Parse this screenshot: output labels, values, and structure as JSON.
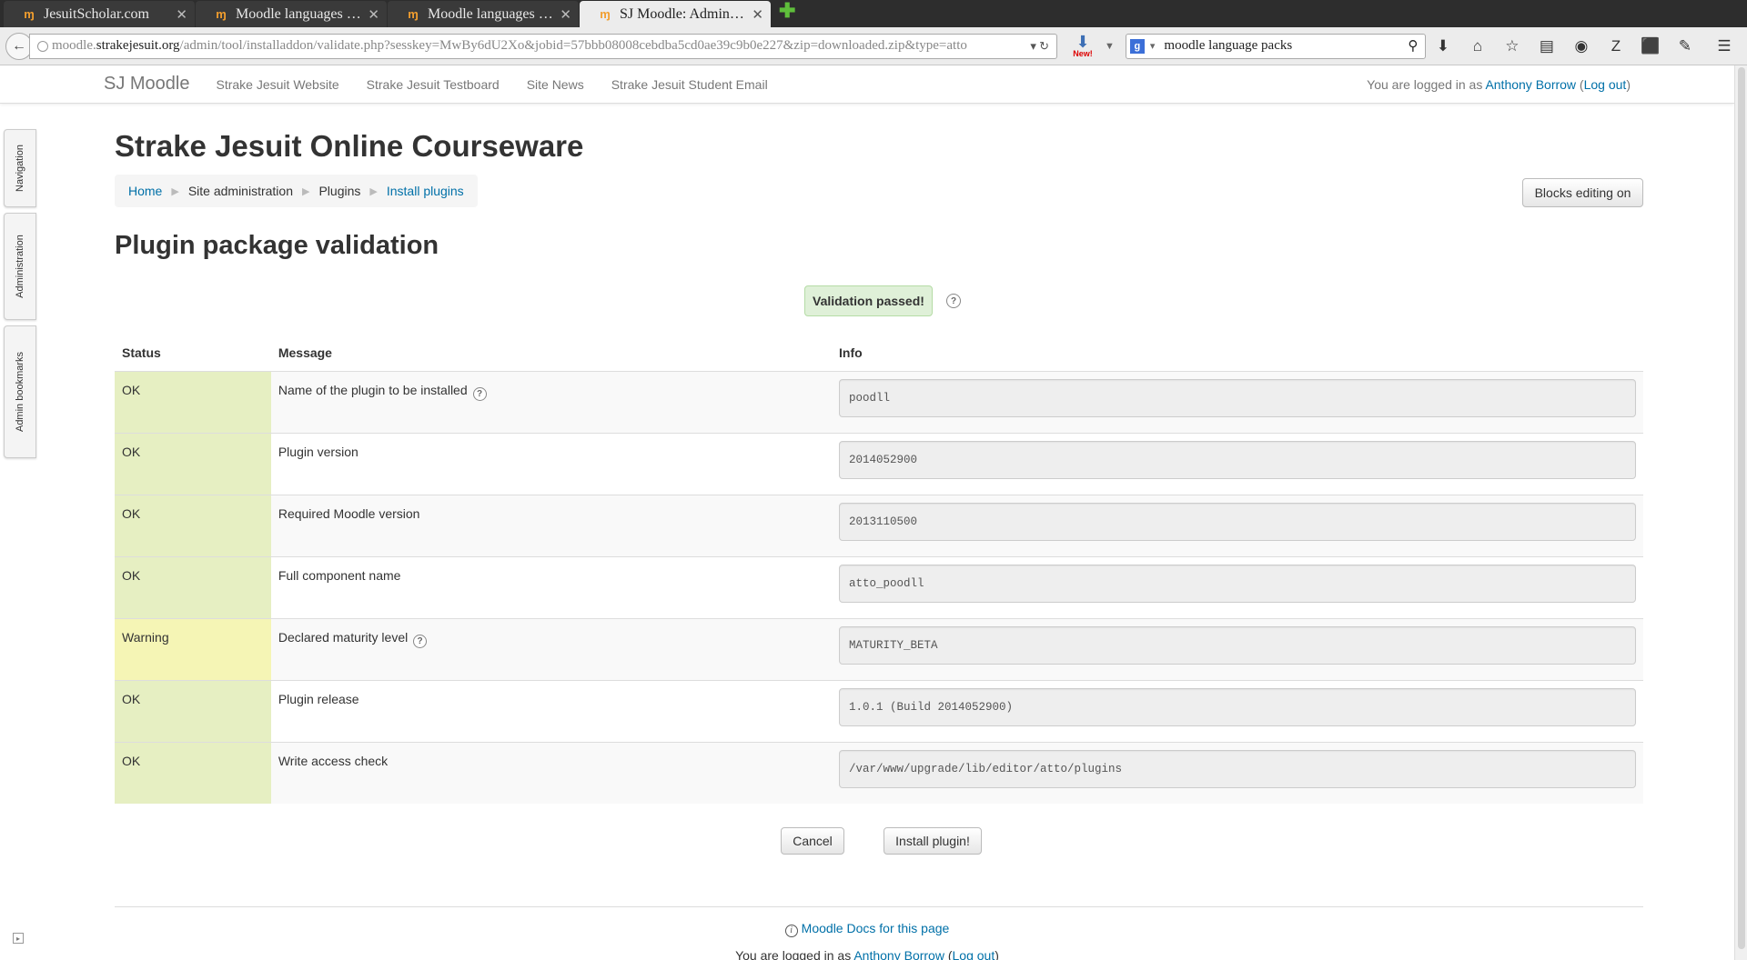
{
  "browser": {
    "tabs": [
      {
        "title": "JesuitScholar.com",
        "active": false
      },
      {
        "title": "Moodle languages po…",
        "active": false
      },
      {
        "title": "Moodle languages po…",
        "active": false
      },
      {
        "title": "SJ Moodle: Administ…",
        "active": true
      }
    ],
    "url_prefix": "moodle.",
    "url_domain": "strakejesuit.org",
    "url_path": "/admin/tool/installaddon/validate.php?sesskey=MwBy6dU2Xo&jobid=57bbb08008cebdba5cd0ae39c9b0e227&zip=downloaded.zip&type=atto",
    "download_badge": "New!",
    "search_value": "moodle language packs",
    "search_engine_glyph": "g"
  },
  "site": {
    "brand": "SJ Moodle",
    "links": [
      "Strake Jesuit Website",
      "Strake Jesuit Testboard",
      "Site News",
      "Strake Jesuit Student Email"
    ],
    "login_prefix": "You are logged in as ",
    "user": "Anthony Borrow",
    "logout": "Log out"
  },
  "side_tabs": [
    "Navigation",
    "Administration",
    "Admin bookmarks"
  ],
  "page": {
    "title": "Strake Jesuit Online Courseware",
    "breadcrumb": [
      "Home",
      "Site administration",
      "Plugins",
      "Install plugins"
    ],
    "blocks_button": "Blocks editing on",
    "heading": "Plugin package validation",
    "validation_status": "Validation passed!"
  },
  "table": {
    "headers": [
      "Status",
      "Message",
      "Info"
    ],
    "rows": [
      {
        "status": "OK",
        "message": "Name of the plugin to be installed",
        "info": "poodll",
        "help": true
      },
      {
        "status": "OK",
        "message": "Plugin version",
        "info": "2014052900",
        "help": false
      },
      {
        "status": "OK",
        "message": "Required Moodle version",
        "info": "2013110500",
        "help": false
      },
      {
        "status": "OK",
        "message": "Full component name",
        "info": "atto_poodll",
        "help": false
      },
      {
        "status": "Warning",
        "message": "Declared maturity level",
        "info": "MATURITY_BETA",
        "help": true
      },
      {
        "status": "OK",
        "message": "Plugin release",
        "info": "1.0.1 (Build 2014052900)",
        "help": false
      },
      {
        "status": "OK",
        "message": "Write access check",
        "info": "/var/www/upgrade/lib/editor/atto/plugins",
        "help": false
      }
    ]
  },
  "actions": {
    "cancel": "Cancel",
    "install": "Install plugin!"
  },
  "footer": {
    "docs_link": "Moodle Docs for this page",
    "login_prefix": "You are logged in as ",
    "user": "Anthony Borrow",
    "logout": "Log out"
  },
  "colors": {
    "ok_cell": "#e6efc2",
    "warning_cell": "#f5f5b5",
    "passed_bg": "#dff0d8",
    "link": "#0070a8"
  }
}
